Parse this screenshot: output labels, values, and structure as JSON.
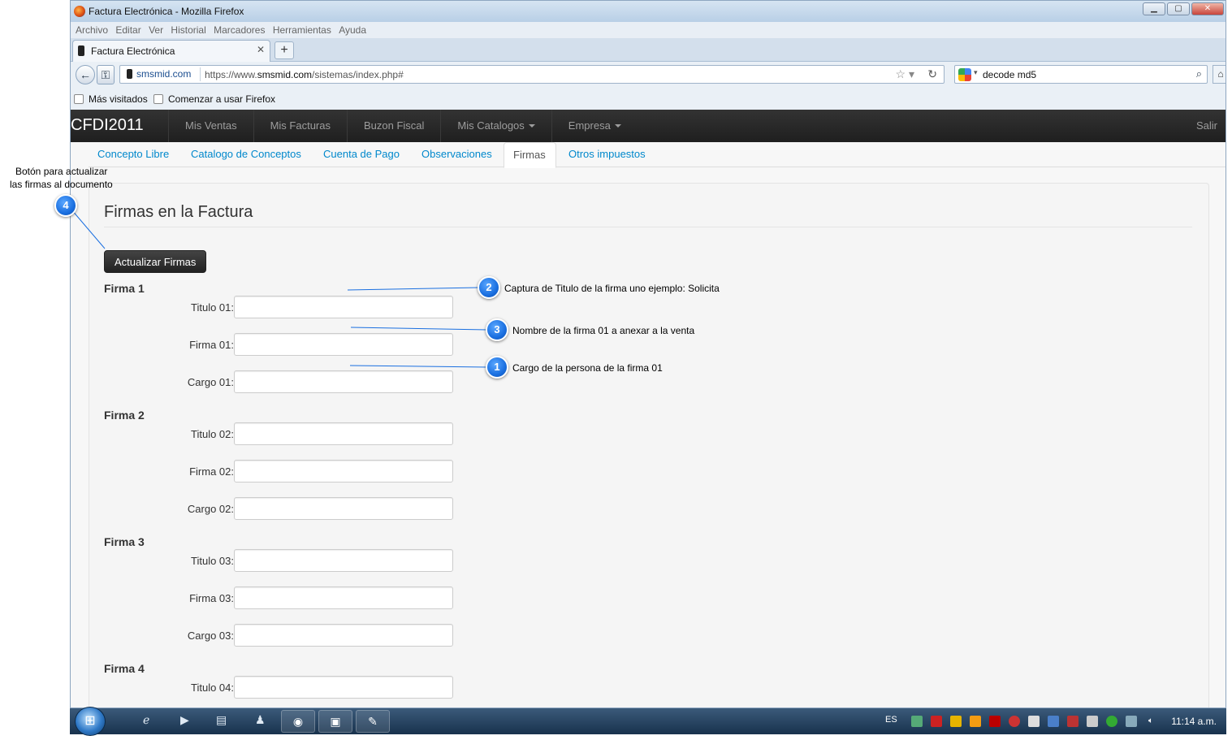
{
  "window": {
    "title": "Factura Electrónica - Mozilla Firefox",
    "controls": {
      "minimize": "▁",
      "maximize": "▢",
      "close": "✕"
    }
  },
  "menu": [
    "Archivo",
    "Editar",
    "Ver",
    "Historial",
    "Marcadores",
    "Herramientas",
    "Ayuda"
  ],
  "tab": {
    "label": "Factura Electrónica",
    "close": "✕",
    "new_tab": "+"
  },
  "address": {
    "site": "smsmid.com",
    "url_prefix": "https://www.",
    "url_domain": "smsmid.com",
    "url_path": "/sistemas/index.php#"
  },
  "search": {
    "query": "decode md5"
  },
  "bookmarks": {
    "most_visited": "Más visitados",
    "getting_started": "Comenzar a usar Firefox"
  },
  "app": {
    "brand": "CFDI2011",
    "nav": [
      "Mis Ventas",
      "Mis Facturas",
      "Buzon Fiscal",
      "Mis Catalogos",
      "Empresa"
    ],
    "logout": "Salir"
  },
  "subtabs": [
    "Concepto Libre",
    "Catalogo de Conceptos",
    "Cuenta de Pago",
    "Observaciones",
    "Firmas",
    "Otros impuestos"
  ],
  "main": {
    "legend": "Firmas en la Factura",
    "update_button": "Actualizar Firmas",
    "sections": [
      {
        "title": "Firma 1",
        "fields": [
          "Titulo 01:",
          "Firma 01:",
          "Cargo 01:"
        ]
      },
      {
        "title": "Firma 2",
        "fields": [
          "Titulo 02:",
          "Firma 02:",
          "Cargo 02:"
        ]
      },
      {
        "title": "Firma 3",
        "fields": [
          "Titulo 03:",
          "Firma 03:",
          "Cargo 03:"
        ]
      },
      {
        "title": "Firma 4",
        "fields": [
          "Titulo 04:"
        ]
      }
    ]
  },
  "callouts": {
    "c1": {
      "num": "1",
      "text": "Cargo de la persona de la firma 01"
    },
    "c2": {
      "num": "2",
      "text": "Captura de Titulo de la firma uno ejemplo: Solicita"
    },
    "c3": {
      "num": "3",
      "text": "Nombre de la firma 01 a anexar a la venta"
    },
    "c4": {
      "num": "4",
      "text_line1": "Botón para actualizar",
      "text_line2": "las firmas al documento"
    }
  },
  "taskbar": {
    "language": "ES",
    "clock": "11:14 a.m."
  },
  "icons": {
    "start": "windows-logo-icon",
    "back": "back-arrow-icon",
    "identity": "key-icon",
    "bookmark_star": "star-icon",
    "reload": "reload-icon",
    "search": "magnifier-icon",
    "home": "home-icon"
  },
  "colors": {
    "link": "#0088cc",
    "navbar": "#222222",
    "callout": "#1a6fe0"
  }
}
